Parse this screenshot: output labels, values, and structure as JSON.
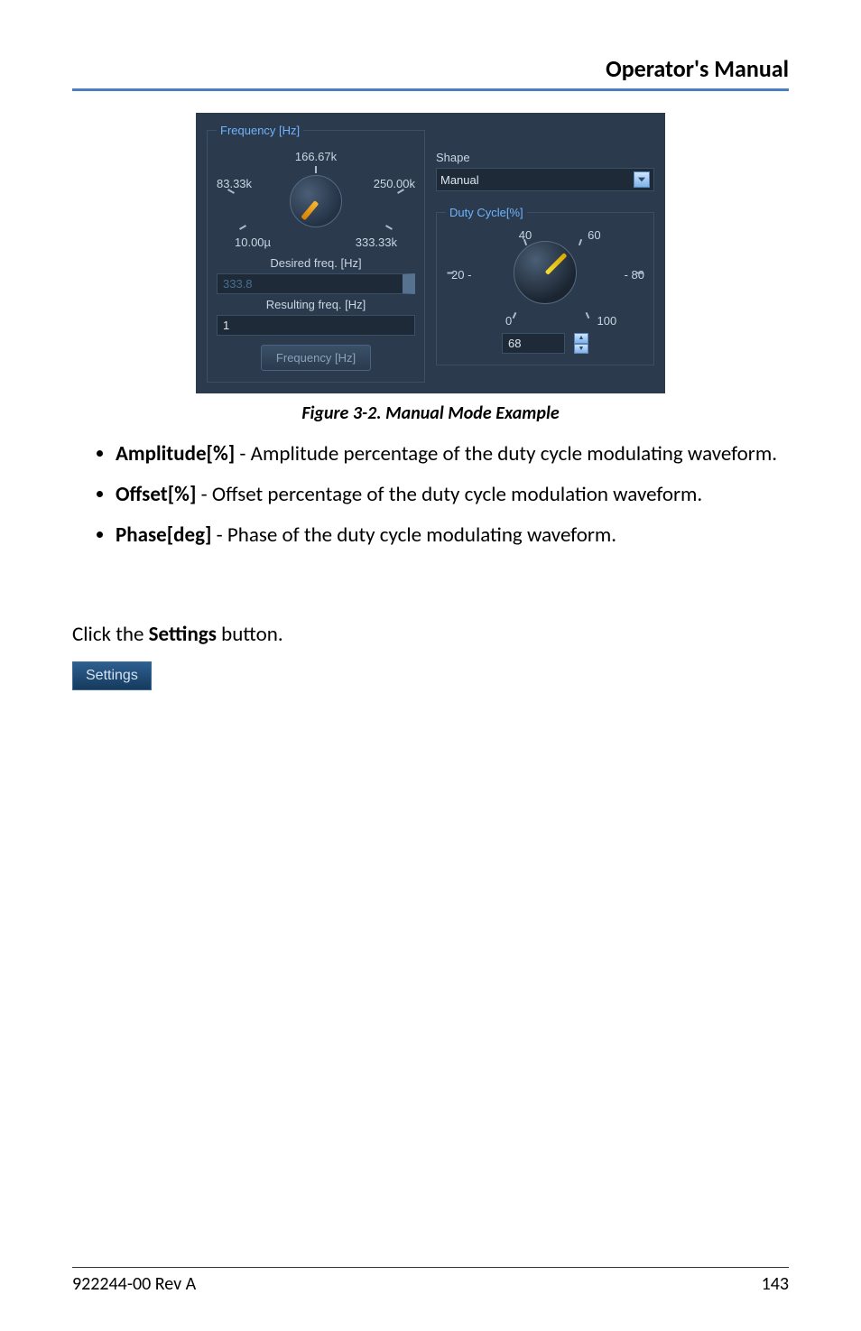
{
  "header": {
    "title": "Operator's Manual"
  },
  "figure": {
    "frequency": {
      "legend": "Frequency [Hz]",
      "dial": {
        "top": "166.67k",
        "left": "83.33k",
        "right": "250.00k",
        "bottom_left": "10.00µ",
        "bottom_right": "333.33k"
      },
      "desired_label": "Desired freq. [Hz]",
      "desired_value": "333.8",
      "resulting_label": "Resulting freq. [Hz]",
      "resulting_value": "1",
      "button": "Frequency [Hz]"
    },
    "shape": {
      "label": "Shape",
      "value": "Manual"
    },
    "duty": {
      "legend": "Duty Cycle[%]",
      "ticks": {
        "t40": "40",
        "t60": "60",
        "t20": "20",
        "t80": "80",
        "t0": "0",
        "t100": "100"
      },
      "dash_l": "-",
      "dash_r": "-",
      "value": "68"
    },
    "caption": "Figure 3-2. Manual Mode Example"
  },
  "list": [
    {
      "term": "Amplitude[%]",
      "desc": " - Amplitude percentage of the duty cycle modulating waveform."
    },
    {
      "term": "Offset[%]",
      "desc": " - Offset percentage of the duty cycle modulation waveform."
    },
    {
      "term": "Phase[deg]",
      "desc": " - Phase of the duty cycle modulating waveform."
    }
  ],
  "settings": {
    "prefix": "Click the ",
    "word": "Settings",
    "suffix": " button.",
    "button": "Settings"
  },
  "footer": {
    "left": "922244-00 Rev A",
    "right": "143"
  }
}
